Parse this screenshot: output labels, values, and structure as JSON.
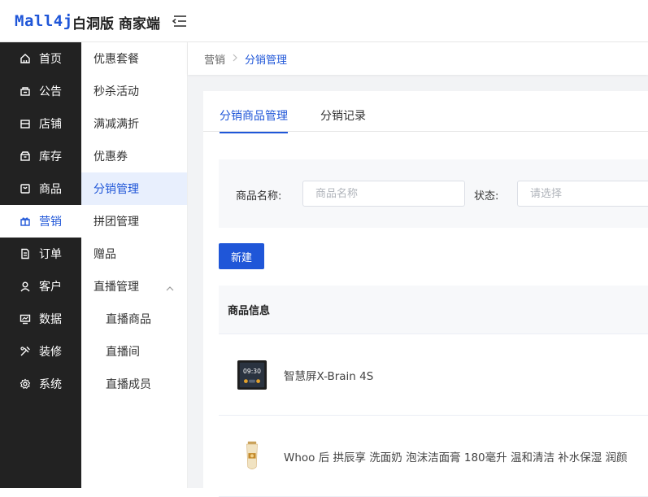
{
  "header": {
    "logo": "Mall4j",
    "brand": "白洞版 商家端"
  },
  "sidebar": {
    "items": [
      {
        "label": "首页",
        "icon": "home-icon"
      },
      {
        "label": "公告",
        "icon": "notice-icon"
      },
      {
        "label": "店铺",
        "icon": "store-icon"
      },
      {
        "label": "库存",
        "icon": "inventory-icon"
      },
      {
        "label": "商品",
        "icon": "product-icon"
      },
      {
        "label": "营销",
        "icon": "gift-icon",
        "active": true
      },
      {
        "label": "订单",
        "icon": "order-icon"
      },
      {
        "label": "客户",
        "icon": "user-icon"
      },
      {
        "label": "数据",
        "icon": "chart-icon"
      },
      {
        "label": "装修",
        "icon": "decorate-icon"
      },
      {
        "label": "系统",
        "icon": "settings-icon"
      }
    ]
  },
  "submenu": {
    "items": [
      {
        "label": "优惠套餐"
      },
      {
        "label": "秒杀活动"
      },
      {
        "label": "满减满折"
      },
      {
        "label": "优惠券"
      },
      {
        "label": "分销管理",
        "active": true
      },
      {
        "label": "拼团管理"
      },
      {
        "label": "赠品"
      },
      {
        "label": "直播管理",
        "expanded": true
      },
      {
        "label": "直播商品",
        "child": true
      },
      {
        "label": "直播间",
        "child": true
      },
      {
        "label": "直播成员",
        "child": true
      }
    ]
  },
  "breadcrumb": {
    "parent": "营销",
    "current": "分销管理"
  },
  "tabs": [
    {
      "label": "分销商品管理",
      "active": true
    },
    {
      "label": "分销记录"
    }
  ],
  "filter": {
    "name_label": "商品名称:",
    "name_placeholder": "商品名称",
    "status_label": "状态:",
    "status_placeholder": "请选择"
  },
  "actions": {
    "new_label": "新建"
  },
  "table": {
    "header": "商品信息",
    "rows": [
      {
        "name": "智慧屏X-Brain 4S",
        "thumb_text": "09:30"
      },
      {
        "name": "Whoo 后 拱辰享 洗面奶 泡沫洁面膏 180毫升 温和清洁 补水保湿 润颜"
      }
    ]
  },
  "colors": {
    "accent": "#1f56d8",
    "sidebar_bg": "#222222"
  }
}
